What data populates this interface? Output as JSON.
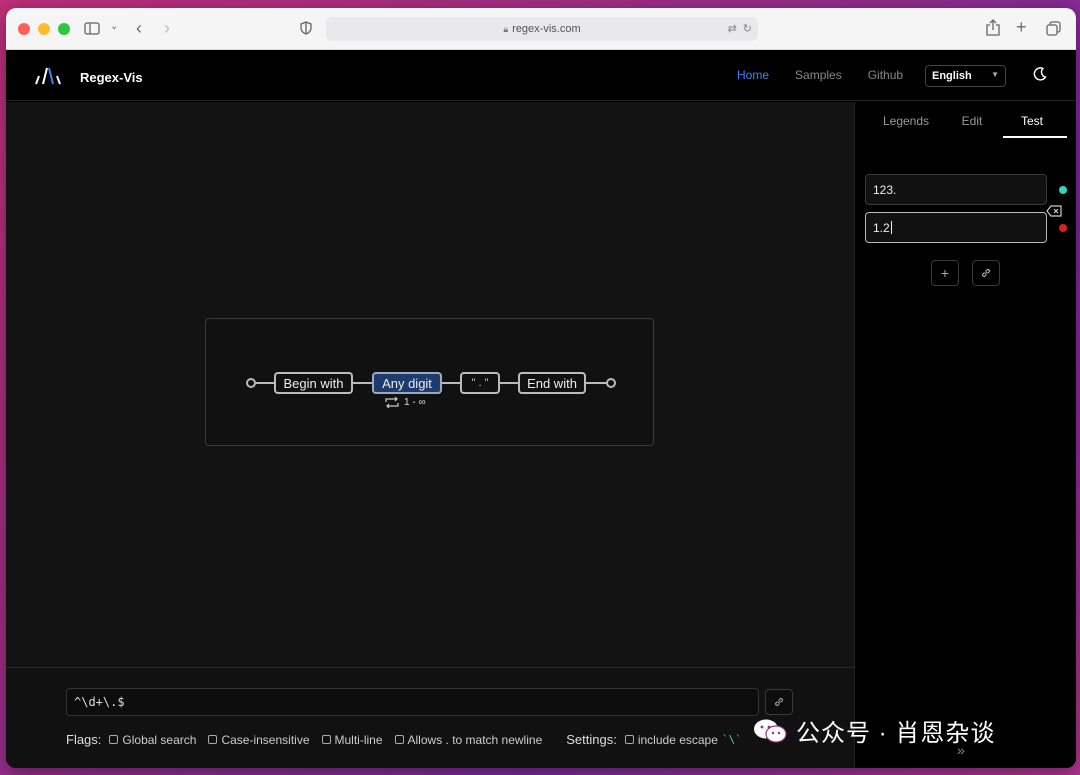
{
  "browser": {
    "url": "regex-vis.com"
  },
  "app": {
    "brand": "Regex-Vis",
    "nav": [
      {
        "label": "Home",
        "active": true
      },
      {
        "label": "Samples",
        "active": false
      },
      {
        "label": "Github",
        "active": false
      }
    ],
    "language": "English"
  },
  "diagram": {
    "nodes": [
      {
        "label": "Begin with",
        "selected": false
      },
      {
        "label": "Any digit",
        "selected": true
      },
      {
        "label": "\" . \"",
        "selected": false
      },
      {
        "label": "End with",
        "selected": false
      }
    ],
    "quantifier": "1 - ∞"
  },
  "regex": {
    "value": "^\\d+\\.$"
  },
  "flags": {
    "label": "Flags:",
    "options": [
      {
        "label": "Global search",
        "checked": false
      },
      {
        "label": "Case-insensitive",
        "checked": false
      },
      {
        "label": "Multi-line",
        "checked": false
      },
      {
        "label": "Allows . to match newline",
        "checked": false
      }
    ],
    "settings_label": "Settings:",
    "settings_option": "include escape",
    "settings_code": "`\\`"
  },
  "panel": {
    "tabs": [
      {
        "label": "Legends",
        "active": false
      },
      {
        "label": "Edit",
        "active": false
      },
      {
        "label": "Test",
        "active": true
      }
    ],
    "tests": [
      {
        "value": "123.",
        "status_color": "#2dd4bf"
      },
      {
        "value": "1.2",
        "status_color": "#e11d1d"
      }
    ]
  },
  "watermark": {
    "text": "公众号 · 肖恩杂谈"
  },
  "colors": {
    "accent": "#3b82f6",
    "match": "#2dd4bf",
    "nomatch": "#e11d1d"
  }
}
